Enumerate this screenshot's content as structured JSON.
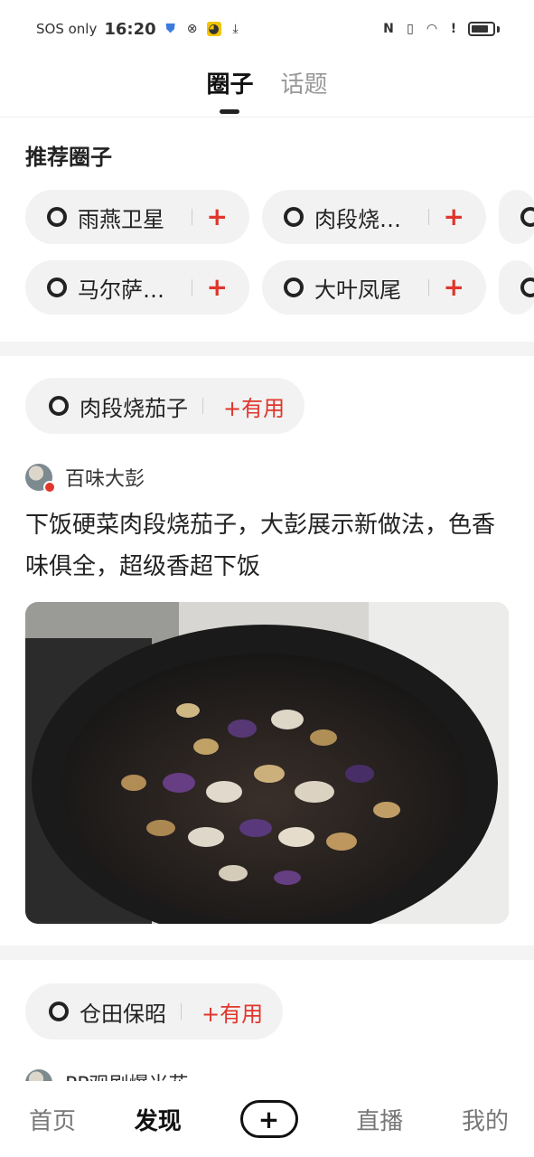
{
  "status_bar": {
    "carrier": "SOS only",
    "time": "16:20"
  },
  "top_tabs": [
    {
      "label": "圈子",
      "active": true
    },
    {
      "label": "话题",
      "active": false
    }
  ],
  "recommended": {
    "title": "推荐圈子",
    "row1": [
      {
        "label": "雨燕卫星"
      },
      {
        "label": "肉段烧…"
      }
    ],
    "row2": [
      {
        "label": "马尔萨…"
      },
      {
        "label": "大叶凤尾"
      }
    ],
    "add_symbol": "+"
  },
  "posts": [
    {
      "topic": "肉段烧茄子",
      "useful": "+有用",
      "author": "百味大彭",
      "title": "下饭硬菜肉段烧茄子，大彭展示新做法，色香味俱全，超级香超下饭"
    },
    {
      "topic": "仓田保昭",
      "useful": "+有用",
      "author": "PP观剧爆米花"
    }
  ],
  "bottom_nav": {
    "home": "首页",
    "discover": "发现",
    "add": "+",
    "live": "直播",
    "mine": "我的"
  },
  "colors": {
    "accent_red": "#e0362c",
    "chip_bg": "#f2f2f2",
    "divider_bg": "#f4f4f4"
  }
}
